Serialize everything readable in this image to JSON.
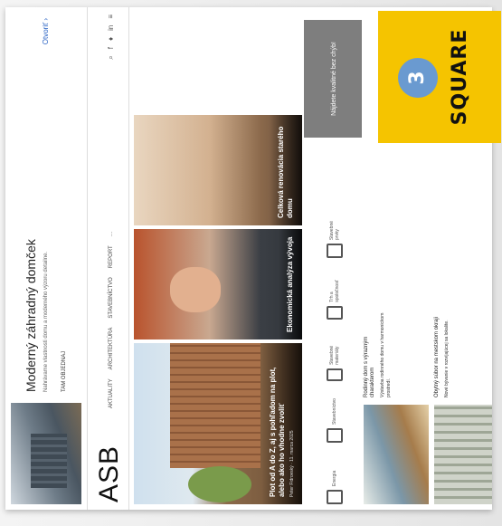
{
  "promo": {
    "title": "Moderný záhradný domček",
    "subtitle": "Nahrávame vlastnosti domu a moderného výzoru detailne.",
    "link": "TAM OBJEDNAJ",
    "button": "Otvoriť ›"
  },
  "nav": {
    "logo": "ASB",
    "items": [
      "AKTUALITY",
      "ARCHITEKTÚRA",
      "STAVEBNÍCTVO",
      "REPORT",
      "…"
    ],
    "icons": [
      "search-icon",
      "facebook-icon",
      "twitter-icon",
      "linkedin-icon",
      "rss-icon"
    ]
  },
  "hero": {
    "main_title": "Plot od A do Z, aj s pohľadom na plot, alebo ako ho vhodne zvoliť",
    "main_meta": "Peter Fidrovský · 11. marca 2025",
    "side1_title": "Ekonomická analýza vývoja",
    "side2_title": "Celková renovácia starého domu"
  },
  "icons_row": [
    {
      "name": "icon-a",
      "label": "Energia"
    },
    {
      "name": "icon-b",
      "label": "Stavebníctvo"
    },
    {
      "name": "icon-c",
      "label": "Stavebné materiály"
    },
    {
      "name": "icon-d",
      "label": "Trh a spoločnosť"
    },
    {
      "name": "icon-e",
      "label": "Stavebné prvky"
    }
  ],
  "newsletter": {
    "label": "Nájdete kvalitné bez chýb!"
  },
  "list": [
    {
      "title": "Rodinný dom s výrazným charakterom",
      "body": "Výstavba rodinného domu v harmonickom prostredí."
    },
    {
      "title": "Obytný súbor na mestskom okraji",
      "body": "Nové bývanie v rozvíjajúcej sa lokalite."
    }
  ],
  "badge": {
    "number": "3",
    "word": "SQUARE",
    "color": "#f5c400"
  }
}
